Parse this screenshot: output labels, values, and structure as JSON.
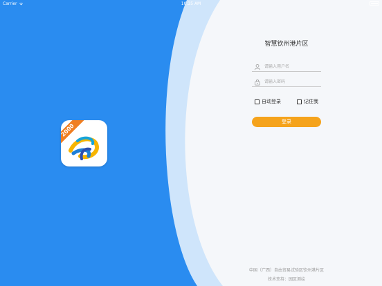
{
  "status_bar": {
    "carrier": "Carrier",
    "time": "10:35 AM"
  },
  "app_icon": {
    "badge": "2000"
  },
  "login": {
    "title": "智慧钦州港片区",
    "username_placeholder": "请输入用户名",
    "password_placeholder": "请输入密码",
    "auto_login_label": "自动登录",
    "remember_label": "记住我",
    "login_button": "登录"
  },
  "footer": {
    "line1": "中国（广西）自由贸易试验区钦州港片区",
    "line2": "技术支持：园区测绘"
  },
  "colors": {
    "primary_blue": "#2a8cf0",
    "light_blue_band": "#cfe5fb",
    "panel_white": "#f5f7fa",
    "accent_orange": "#f5a31c",
    "badge_orange": "#f07e21"
  }
}
